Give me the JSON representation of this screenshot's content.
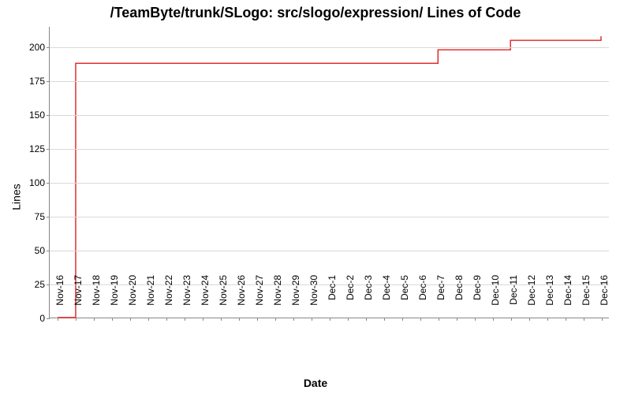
{
  "chart_data": {
    "type": "line",
    "title": "/TeamByte/trunk/SLogo: src/slogo/expression/ Lines of Code",
    "xlabel": "Date",
    "ylabel": "Lines",
    "ylim": [
      0,
      215
    ],
    "yticks": [
      0,
      25,
      50,
      75,
      100,
      125,
      150,
      175,
      200
    ],
    "categories": [
      "16-Nov",
      "17-Nov",
      "18-Nov",
      "19-Nov",
      "20-Nov",
      "21-Nov",
      "22-Nov",
      "23-Nov",
      "24-Nov",
      "25-Nov",
      "26-Nov",
      "27-Nov",
      "28-Nov",
      "29-Nov",
      "30-Nov",
      "1-Dec",
      "2-Dec",
      "3-Dec",
      "4-Dec",
      "5-Dec",
      "6-Dec",
      "7-Dec",
      "8-Dec",
      "9-Dec",
      "10-Dec",
      "11-Dec",
      "12-Dec",
      "13-Dec",
      "14-Dec",
      "15-Dec",
      "16-Dec"
    ],
    "series": [
      {
        "name": "Lines of Code",
        "color": "#e02020",
        "values": [
          0,
          188,
          188,
          188,
          188,
          188,
          188,
          188,
          188,
          188,
          188,
          188,
          188,
          188,
          188,
          188,
          188,
          188,
          188,
          188,
          188,
          198,
          198,
          198,
          198,
          205,
          205,
          205,
          205,
          205,
          208
        ]
      }
    ]
  }
}
